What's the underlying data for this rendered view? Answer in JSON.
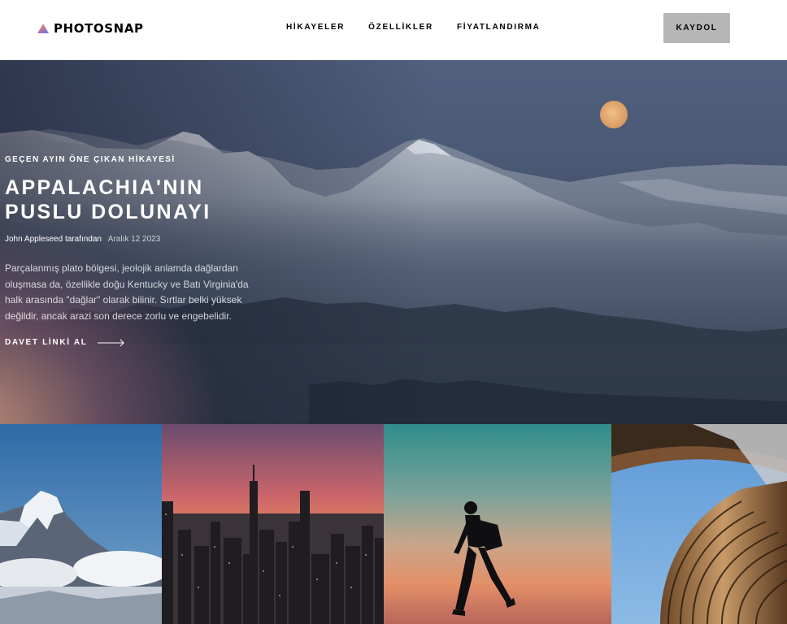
{
  "brand": {
    "name": "PHOTOSNAP",
    "logo_icon": "triangle-gradient-icon"
  },
  "nav": {
    "items": [
      {
        "label": "HİKAYELER"
      },
      {
        "label": "ÖZELLİKLER"
      },
      {
        "label": "FİYATLANDIRMA"
      }
    ],
    "signup_label": "KAYDOL"
  },
  "hero": {
    "eyebrow": "GEÇEN AYIN ÖNE ÇIKAN HİKAYESİ",
    "title": "APPALACHIA'NIN PUSLU DOLUNAYI",
    "author": "John Appleseed tarafından",
    "date": "Aralık 12 2023",
    "description": "Parçalanmış plato bölgesi, jeolojik anlamda dağlardan oluşmasa da, özellikle doğu Kentucky ve Batı Virginia'da halk arasında \"dağlar\" olarak bilinir. Sırtlar belki yüksek değildir, ancak arazi son derece zorlu ve engebelidir.",
    "cta_label": "DAVET LİNKİ AL",
    "cta_icon": "arrow-right-icon"
  },
  "colors": {
    "signup_bg": "#b6b6b6",
    "logo_gradient": [
      "#ffc593",
      "#bc7198",
      "#5a77ff"
    ],
    "moon": "#e2a66e"
  },
  "gallery": {
    "tiles": [
      {
        "subject": "snowy-mountain-peak"
      },
      {
        "subject": "city-skyline-sunset"
      },
      {
        "subject": "hiker-silhouette-sunset"
      },
      {
        "subject": "curved-architecture"
      }
    ]
  }
}
